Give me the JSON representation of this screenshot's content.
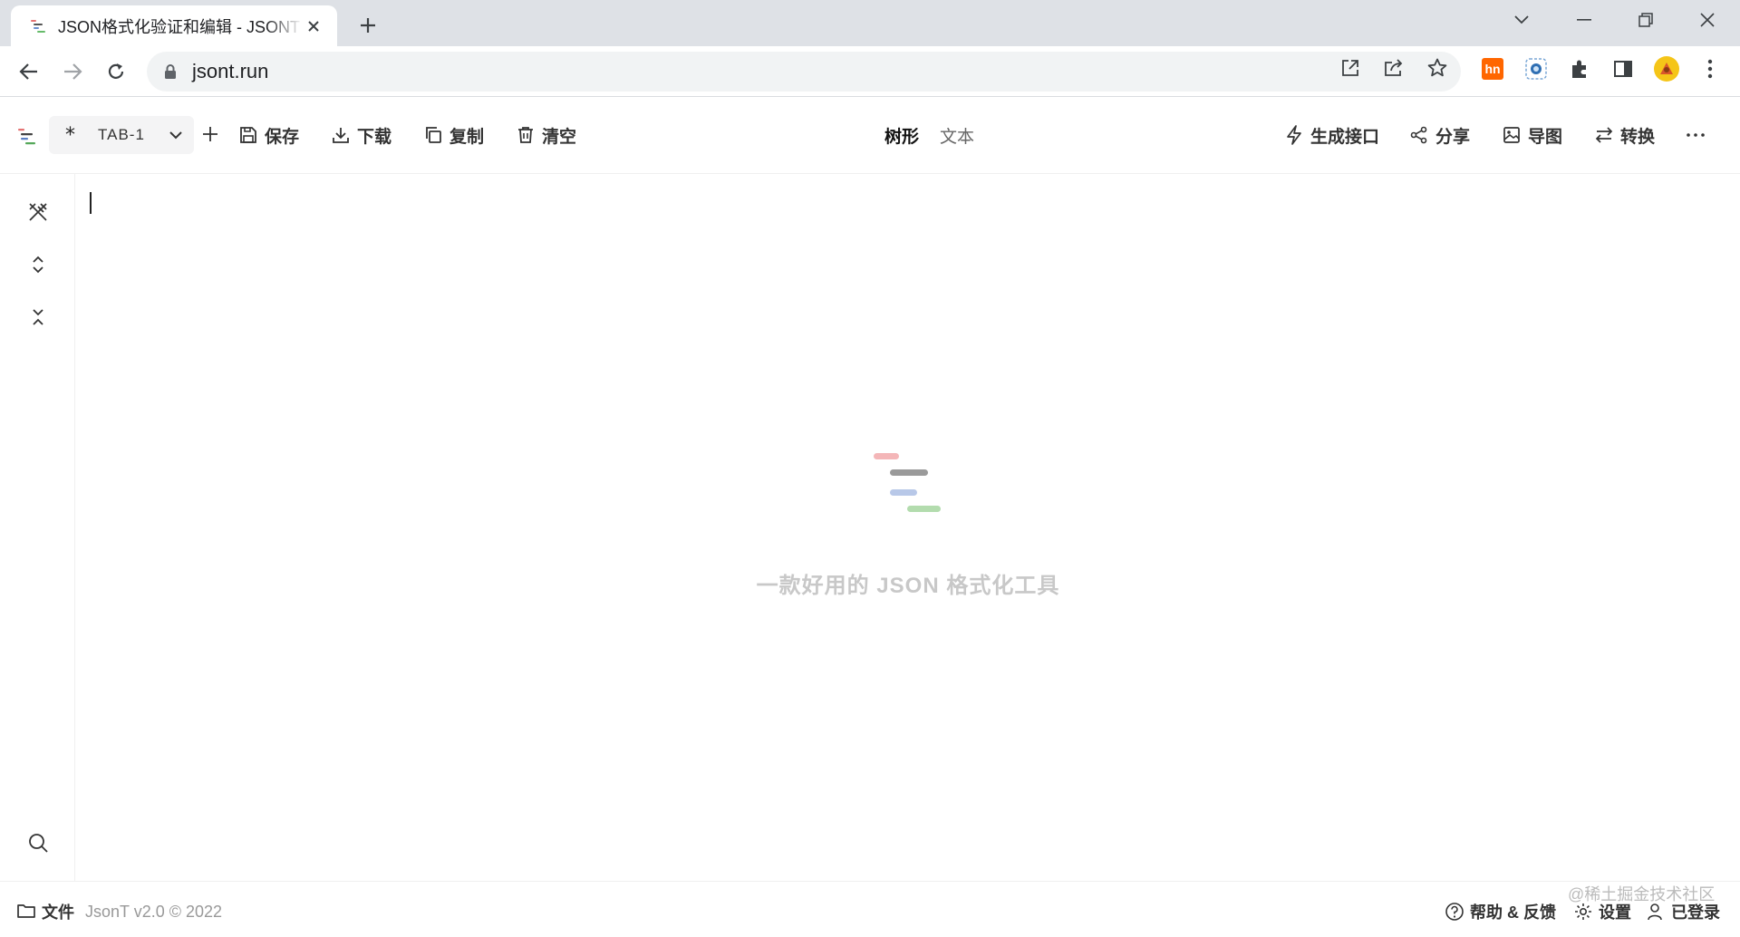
{
  "browser": {
    "tab_title": "JSON格式化验证和编辑 - JSONT",
    "url": "jsont.run",
    "ext_hn_label": "hn"
  },
  "toolbar": {
    "tab_name": "TAB-1",
    "tab_prefix": "*",
    "save": "保存",
    "download": "下载",
    "copy": "复制",
    "clear": "清空",
    "mode_tree": "树形",
    "mode_text": "文本",
    "gen_api": "生成接口",
    "share": "分享",
    "export_image": "导图",
    "convert": "转换"
  },
  "editor": {
    "tagline": "一款好用的 JSON 格式化工具"
  },
  "footer": {
    "files": "文件",
    "version": "JsonT v2.0 © 2022",
    "help": "帮助 & 反馈",
    "settings": "设置",
    "login": "已登录",
    "watermark": "@稀土掘金技术社区"
  },
  "colors": {
    "logo_red": "#f4b6b8",
    "logo_gray": "#9a9a9a",
    "logo_blue": "#b8c8e8",
    "logo_green": "#b3dcae",
    "ext_hn": "#ff6600"
  }
}
